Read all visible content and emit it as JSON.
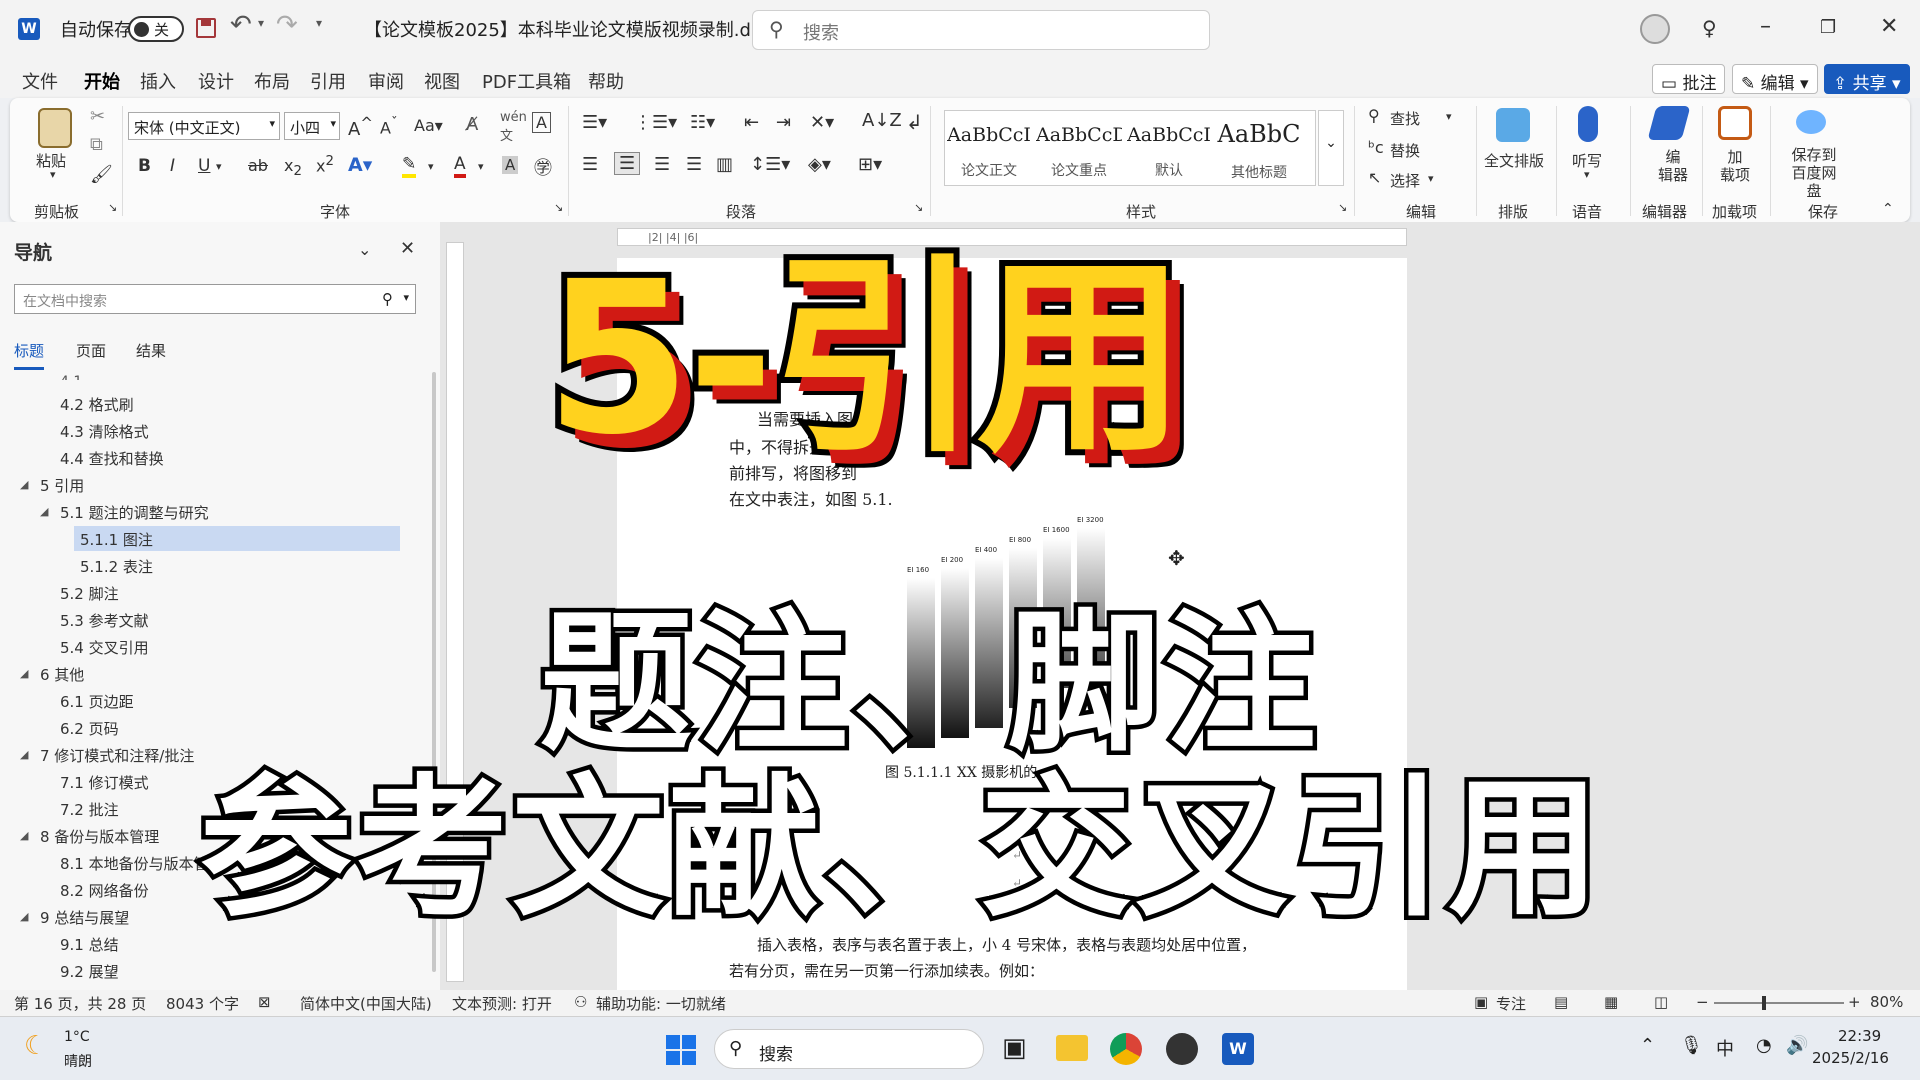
{
  "titlebar": {
    "autosave_label": "自动保存",
    "autosave_state": "关",
    "doc_title": "【论文模板2025】本科毕业论文模版视频录制.d...",
    "search_placeholder": "搜索"
  },
  "menu": {
    "items": [
      "文件",
      "开始",
      "插入",
      "设计",
      "布局",
      "引用",
      "审阅",
      "视图",
      "PDF工具箱",
      "帮助"
    ],
    "active": "开始",
    "comment_btn": "批注",
    "edit_btn": "编辑",
    "share_btn": "共享"
  },
  "ribbon": {
    "paste": "粘贴",
    "font_name": "宋体 (中文正文)",
    "font_size": "小四",
    "groups": [
      "剪贴板",
      "字体",
      "段落",
      "样式",
      "编辑",
      "排版",
      "语音",
      "编辑器",
      "加载项",
      "保存"
    ],
    "styles": [
      {
        "sample": "AaBbCcI",
        "name": "论文正文"
      },
      {
        "sample": "AaBbCcDc",
        "name": "论文重点"
      },
      {
        "sample": "AaBbCcI",
        "name": "默认"
      },
      {
        "sample": "AaBbC",
        "name": "其他标题"
      }
    ],
    "find": "查找",
    "replace": "替换",
    "select": "选择",
    "layout_all": "全文排版",
    "dictate": "听写",
    "editor": "编辑器",
    "addins": "加载项",
    "save_baidu": "保存到百度网盘"
  },
  "nav": {
    "title": "导航",
    "search_placeholder": "在文档中搜索",
    "tabs": [
      "标题",
      "页面",
      "结果"
    ],
    "active_tab": "标题",
    "items": [
      {
        "text": "4.2 格式刷",
        "level": 2
      },
      {
        "text": "4.3 清除格式",
        "level": 2
      },
      {
        "text": "4.4 查找和替换",
        "level": 2
      },
      {
        "text": "5 引用",
        "level": 1
      },
      {
        "text": "5.1 题注的调整与研究",
        "level": 2
      },
      {
        "text": "5.1.1 图注",
        "level": 3,
        "selected": true
      },
      {
        "text": "5.1.2 表注",
        "level": 3
      },
      {
        "text": "5.2 脚注",
        "level": 2
      },
      {
        "text": "5.3 参考文献",
        "level": 2
      },
      {
        "text": "5.4 交叉引用",
        "level": 2
      },
      {
        "text": "6 其他",
        "level": 1
      },
      {
        "text": "6.1 页边距",
        "level": 2
      },
      {
        "text": "6.2 页码",
        "level": 2
      },
      {
        "text": "7 修订模式和注释/批注",
        "level": 1
      },
      {
        "text": "7.1 修订模式",
        "level": 2
      },
      {
        "text": "7.2 批注",
        "level": 2
      },
      {
        "text": "8 备份与版本管理",
        "level": 1
      },
      {
        "text": "8.1 本地备份与版本管理",
        "level": 2
      },
      {
        "text": "8.2 网络备份",
        "level": 2
      },
      {
        "text": "9 总结与展望",
        "level": 1
      },
      {
        "text": "9.1 总结",
        "level": 2
      },
      {
        "text": "9.2 展望",
        "level": 2
      }
    ]
  },
  "document": {
    "line1": "当需要插入图片时，",
    "line2": "中，不得拆开排写",
    "line3": "前排写，将图移到",
    "line4": "在文中表注，如图 5.1.",
    "caption": "图 5.1.1.1 XX 摄影机的",
    "chart_labels": [
      "EI 160",
      "EI 200",
      "EI 400",
      "EI 800",
      "EI 1600",
      "EI 3200"
    ],
    "table_line1": "插入表格，表序与表名置于表上，小 4 号宋体，表格与表题均处居中位置，",
    "table_line2": "若有分页，需在另一页第一行添加续表。例如："
  },
  "overlay": {
    "title": "5-引用",
    "subtitle1": "题注、脚注",
    "subtitle2": "参考文献、交叉引用"
  },
  "status": {
    "page": "第 16 页，共 28 页",
    "words": "8043 个字",
    "language": "简体中文(中国大陆)",
    "prediction": "文本预测: 打开",
    "accessibility": "辅助功能: 一切就绪",
    "focus": "专注",
    "zoom": "80%"
  },
  "taskbar": {
    "temp": "1°C",
    "weather": "晴朗",
    "search": "搜索",
    "ime": "中",
    "time": "22:39",
    "date": "2025/2/16"
  }
}
